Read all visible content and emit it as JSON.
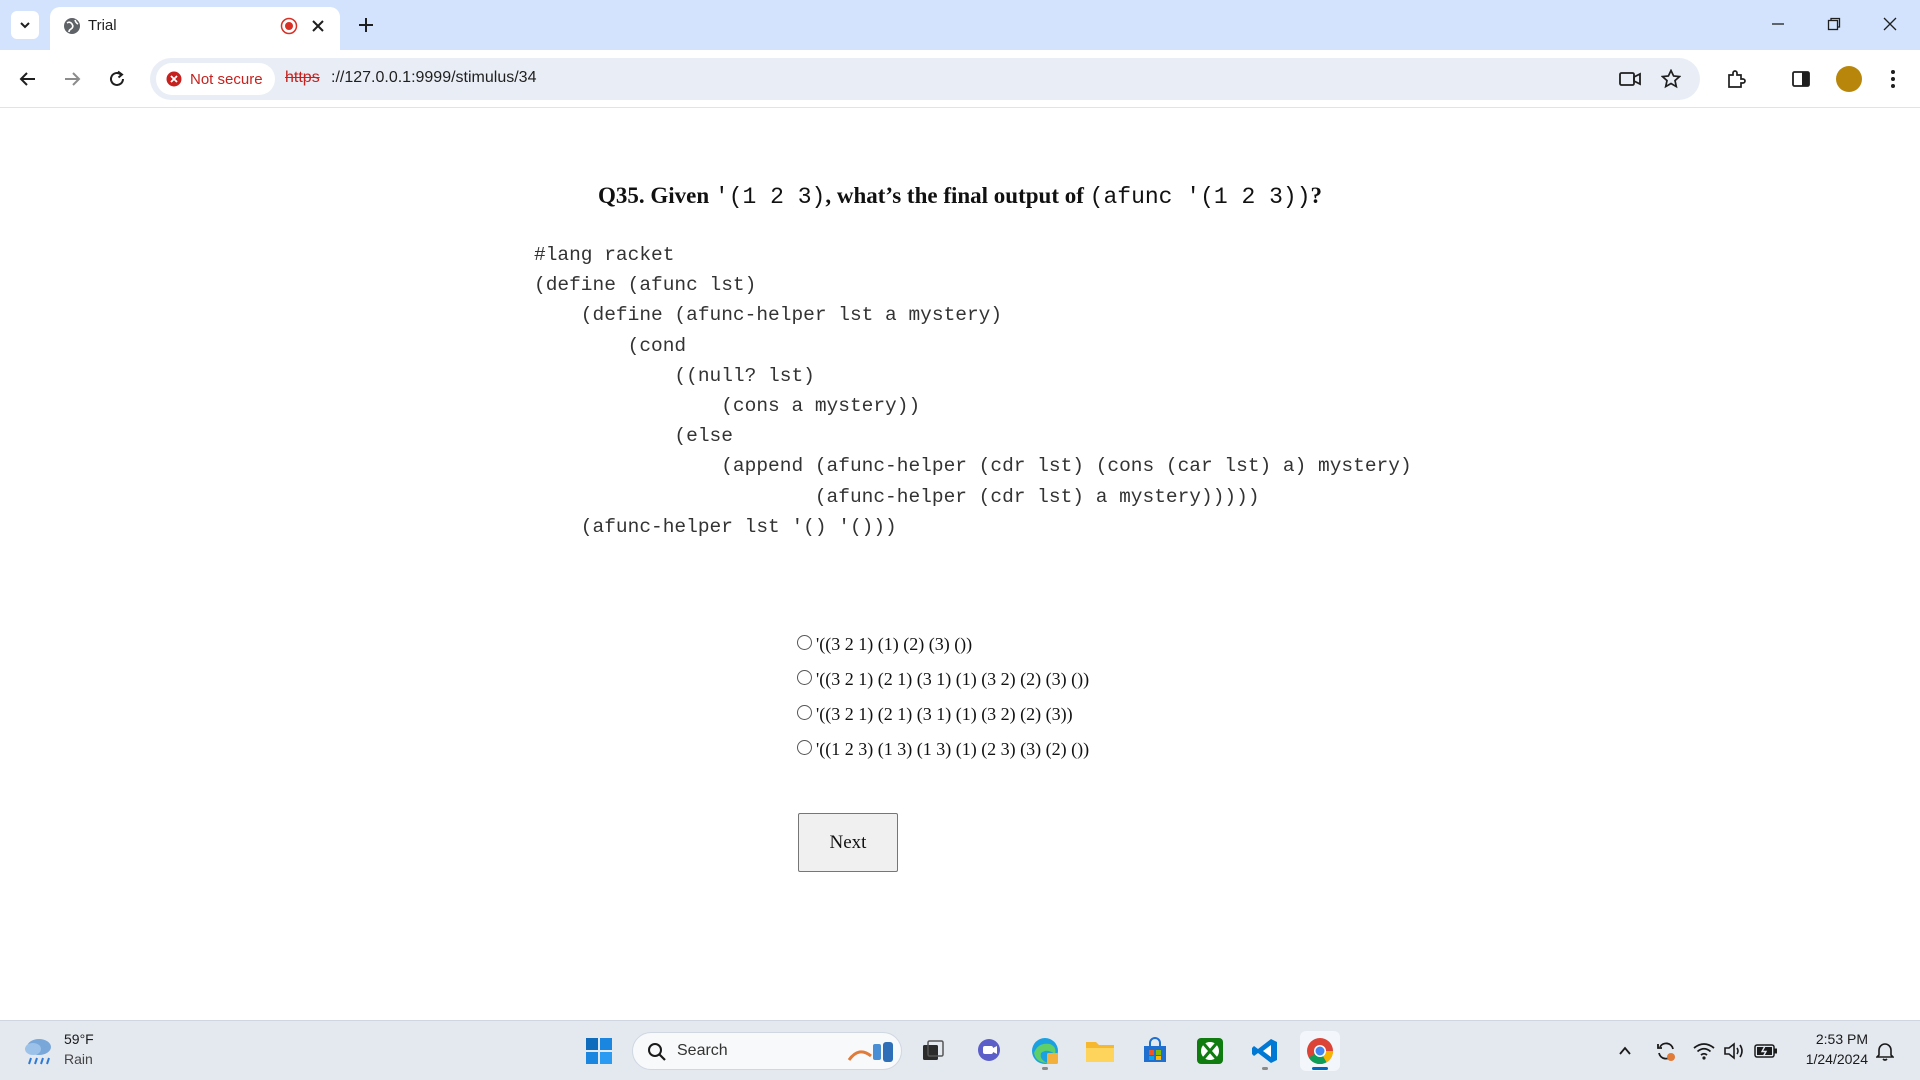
{
  "browser": {
    "tab_title": "Trial",
    "security_label": "Not secure",
    "url_scheme": "https",
    "url_rest": "://127.0.0.1:9999/stimulus/34"
  },
  "question": {
    "prefix": "Q35. Given ",
    "list_literal": "'(1 2 3)",
    "middle": ", what’s the final output of ",
    "call_expr": "(afunc '(1 2 3))",
    "suffix": "?"
  },
  "code_lines": [
    "#lang racket",
    "(define (afunc lst)",
    "    (define (afunc-helper lst a mystery)",
    "        (cond",
    "            ((null? lst)",
    "                (cons a mystery))",
    "            (else",
    "                (append (afunc-helper (cdr lst) (cons (car lst) a) mystery)",
    "                        (afunc-helper (cdr lst) a mystery)))))",
    "    (afunc-helper lst '() '()))"
  ],
  "options": [
    "'((3 2 1) (1) (2) (3) ())",
    "'((3 2 1) (2 1) (3 1) (1) (3 2) (2) (3) ())",
    "'((3 2 1) (2 1) (3 1) (1) (3 2) (2) (3))",
    "'((1 2 3) (1 3) (1 3) (1) (2 3) (3) (2) ())"
  ],
  "next_label": "Next",
  "taskbar": {
    "weather_temp": "59°F",
    "weather_cond": "Rain",
    "search_placeholder": "Search",
    "clock_time": "2:53 PM",
    "clock_date": "1/24/2024"
  },
  "colors": {
    "tabstrip": "#d3e3fd",
    "omnibox": "#e9eef6",
    "insecure_red": "#c5221f",
    "taskbar": "#e4e9f0"
  }
}
